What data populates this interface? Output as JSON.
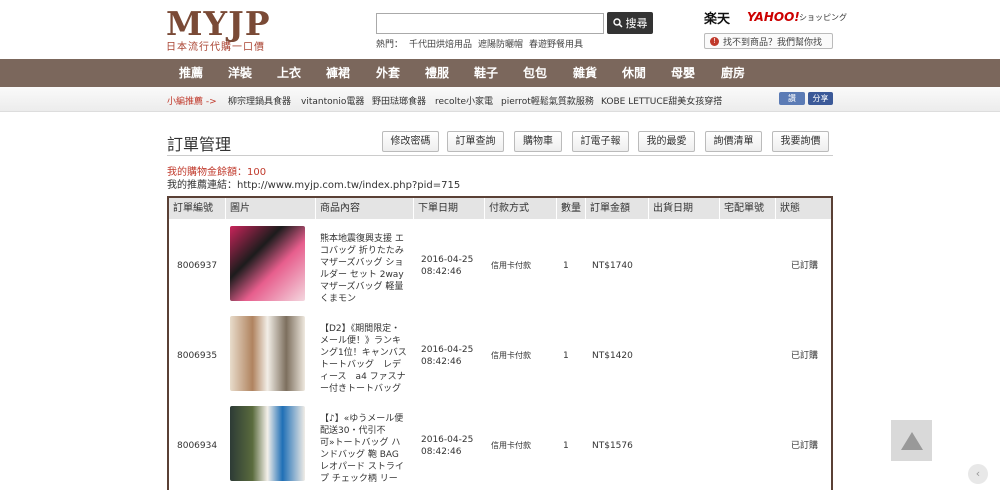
{
  "logo": {
    "text": "MYJP",
    "sub": "日本流行代購一口價"
  },
  "search": {
    "placeholder": "",
    "button": "搜尋",
    "hot_label": "熱門：",
    "hot": [
      "千代田烘焙用品",
      "遮陽防曬帽",
      "春遊野餐用具"
    ]
  },
  "partners": {
    "rakuten": "楽天",
    "yahoo": "YAHOO!",
    "shopping": "ショッピング",
    "help": "找不到商品？我們幫你找"
  },
  "nav": [
    "推薦",
    "洋裝",
    "上衣",
    "褲裙",
    "外套",
    "禮服",
    "鞋子",
    "包包",
    "雜貨",
    "休閒",
    "母嬰",
    "廚房"
  ],
  "subnav": {
    "editor": "小編推薦 ->",
    "items": [
      "柳宗理鍋具食器",
      "vitantonio電器",
      "野田琺瑯食器",
      "recolte小家電",
      "pierrot輕鬆氣質款服務",
      "KOBE LETTUCE甜美女孩穿搭"
    ],
    "like": "讚",
    "share": "分享"
  },
  "page": {
    "title": "訂單管理",
    "buttons": [
      "修改密碼",
      "訂單查詢",
      "購物車",
      "訂電子報",
      "我的最愛",
      "詢價清單",
      "我要詢價"
    ],
    "amount_label": "我的購物金餘額：",
    "amount_value": "100",
    "reflink": "我的推薦連結：http://www.myjp.com.tw/index.php?pid=715"
  },
  "table": {
    "headers": [
      "訂單編號",
      "圖片",
      "商品內容",
      "下單日期",
      "付款方式",
      "數量",
      "訂單金額",
      "出貨日期",
      "宅配單號",
      "狀態"
    ],
    "rows": [
      {
        "id": "8006937",
        "desc": "熊本地震復興支援 エコバッグ 折りたたみ マザーズバッグ ショルダー セット 2way マザーズバッグ 軽量 くまモン",
        "date": "2016-04-25",
        "time": "08:42:46",
        "pay": "信用卡付款",
        "qty": "1",
        "amount": "NT$1740",
        "ship": "",
        "track": "",
        "status": "已訂購"
      },
      {
        "id": "8006935",
        "desc": "【D2】《期間限定・メール便！》ランキング1位！キャンバストートバッグ　レディース　a4 ファスナー付きトートバッグ",
        "date": "2016-04-25",
        "time": "08:42:46",
        "pay": "信用卡付款",
        "qty": "1",
        "amount": "NT$1420",
        "ship": "",
        "track": "",
        "status": "已訂購"
      },
      {
        "id": "8006934",
        "desc": "【♪】«ゆうメール便配送30・代引不可»トートバッグ ハンドバッグ 鞄 BAG レオパード ストライプ チェック柄 リー",
        "date": "2016-04-25",
        "time": "08:42:46",
        "pay": "信用卡付款",
        "qty": "1",
        "amount": "NT$1576",
        "ship": "",
        "track": "",
        "status": "已訂購"
      }
    ]
  },
  "colors": {
    "nav": "#7b675c",
    "accent": "#c0392b",
    "table_border": "#5a4035"
  }
}
